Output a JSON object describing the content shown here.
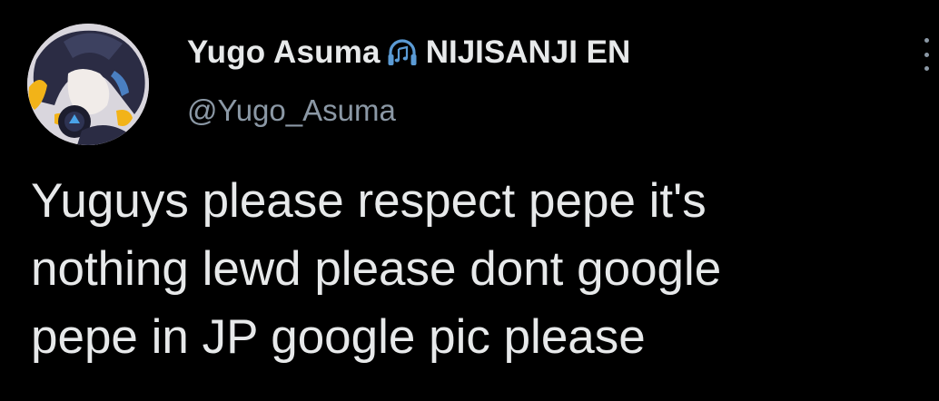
{
  "author": {
    "display_name": "Yugo Asuma",
    "name_emoji": "headphone-music-icon",
    "affiliation": "NIJISANJI EN",
    "handle": "@Yugo_Asuma"
  },
  "tweet": {
    "lines": [
      "Yuguys please respect pepe it's",
      "nothing lewd please dont google",
      "pepe in JP google pic please"
    ]
  },
  "colors": {
    "background": "#000000",
    "text_primary": "#e7e9ea",
    "text_secondary": "#8b98a5",
    "emoji_blue": "#5b9bd5"
  }
}
